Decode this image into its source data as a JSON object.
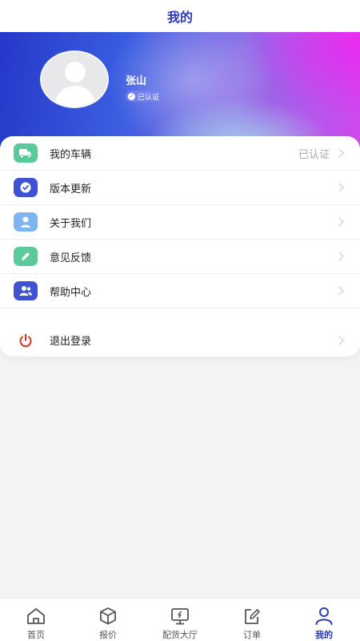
{
  "header": {
    "title": "我的"
  },
  "profile": {
    "name": "张山",
    "badge": "已认证"
  },
  "menu": {
    "items": [
      {
        "label": "我的车辆",
        "status": "已认证",
        "icon": "truck-icon",
        "color": "#5cc99a"
      },
      {
        "label": "版本更新",
        "icon": "check-circle-icon",
        "color": "#3f52d4"
      },
      {
        "label": "关于我们",
        "icon": "user-icon",
        "color": "#7fb4ef"
      },
      {
        "label": "意见反馈",
        "icon": "pencil-icon",
        "color": "#5cc99a"
      },
      {
        "label": "帮助中心",
        "icon": "users-icon",
        "color": "#3f52d4"
      }
    ],
    "logout": {
      "label": "退出登录",
      "icon": "power-icon",
      "color": "#d9341f"
    }
  },
  "bottom_nav": {
    "active": "我的",
    "items": [
      {
        "label": "首页",
        "icon": "home-icon"
      },
      {
        "label": "报价",
        "icon": "box-icon"
      },
      {
        "label": "配货大厅",
        "icon": "monitor-icon"
      },
      {
        "label": "订单",
        "icon": "edit-icon"
      },
      {
        "label": "我的",
        "icon": "person-icon"
      }
    ]
  },
  "colors": {
    "accent": "#2a3bb8",
    "inactive_nav": "#555555"
  }
}
